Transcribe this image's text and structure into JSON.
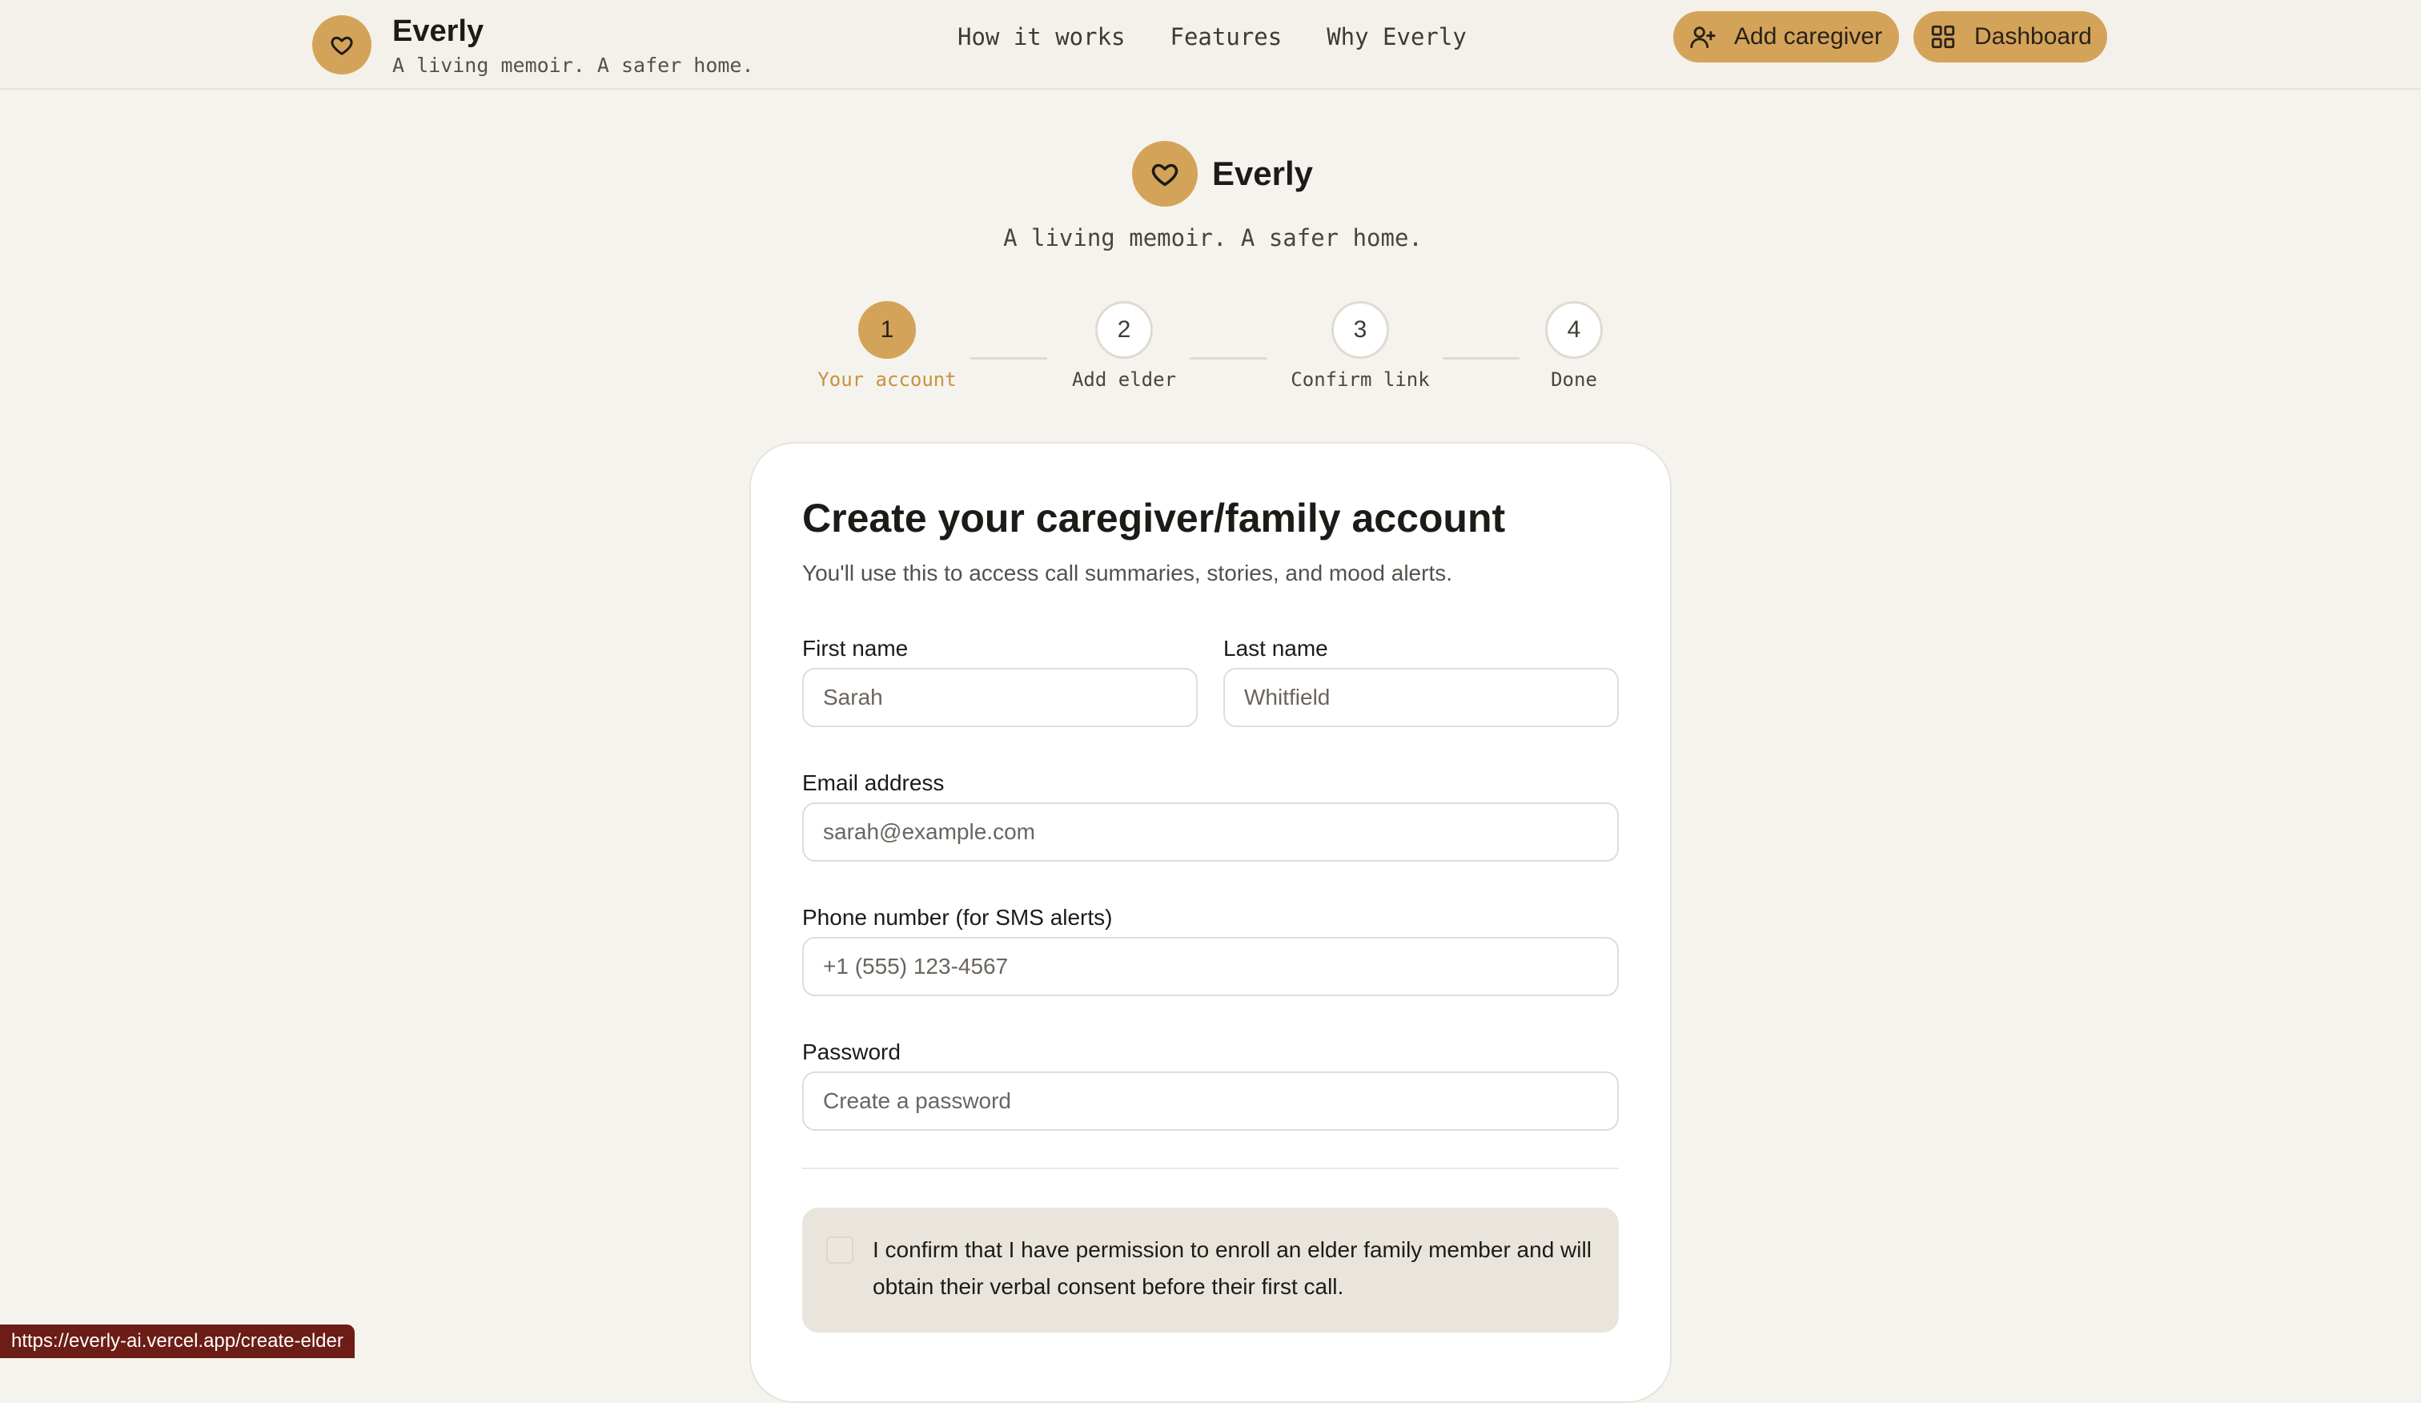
{
  "header": {
    "brand_name": "Everly",
    "brand_tagline": "A living memoir. A safer home.",
    "nav": [
      "How it works",
      "Features",
      "Why Everly"
    ],
    "add_caregiver_label": "Add caregiver",
    "dashboard_label": "Dashboard"
  },
  "hero": {
    "name": "Everly",
    "tagline": "A living memoir. A safer home."
  },
  "steps": [
    {
      "num": "1",
      "label": "Your account",
      "active": true
    },
    {
      "num": "2",
      "label": "Add elder",
      "active": false
    },
    {
      "num": "3",
      "label": "Confirm link",
      "active": false
    },
    {
      "num": "4",
      "label": "Done",
      "active": false
    }
  ],
  "form": {
    "title": "Create your caregiver/family account",
    "subtitle": "You'll use this to access call summaries, stories, and mood alerts.",
    "first_name_label": "First name",
    "first_name_placeholder": "Sarah",
    "last_name_label": "Last name",
    "last_name_placeholder": "Whitfield",
    "email_label": "Email address",
    "email_placeholder": "sarah@example.com",
    "phone_label": "Phone number (for SMS alerts)",
    "phone_placeholder": "+1 (555) 123-4567",
    "password_label": "Password",
    "password_placeholder": "Create a password",
    "consent_text": "I confirm that I have permission to enroll an elder family member and will obtain their verbal consent before their first call."
  },
  "status_bar": {
    "url": "https://everly-ai.vercel.app/create-elder"
  },
  "colors": {
    "accent": "#d4a35a",
    "background": "#f5f3ee",
    "active_step_text": "#c8923f"
  },
  "icons": {
    "logo": "heart-icon",
    "add_caregiver": "user-plus-icon",
    "dashboard": "grid-icon"
  }
}
